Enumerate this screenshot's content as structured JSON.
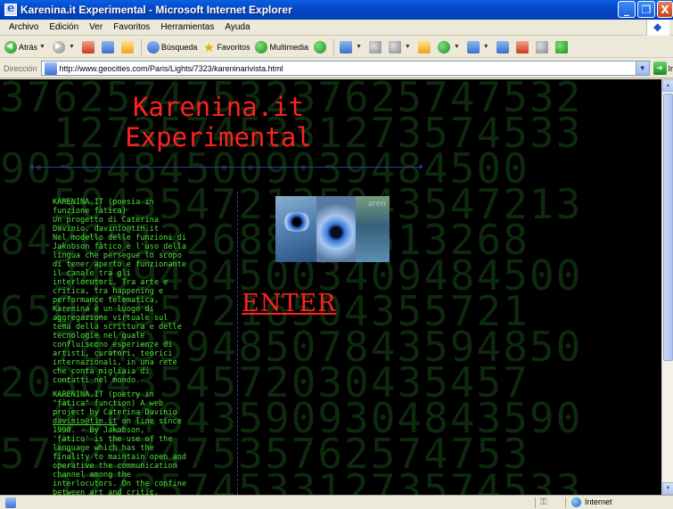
{
  "window": {
    "title": "Karenina.it Experimental - Microsoft Internet Explorer",
    "controls": [
      "_",
      "❐",
      "X"
    ]
  },
  "menu": [
    "Archivo",
    "Edición",
    "Ver",
    "Favoritos",
    "Herramientas",
    "Ayuda"
  ],
  "toolbar": {
    "back_label": "Atrás",
    "search_label": "Búsqueda",
    "favorites_label": "Favoritos",
    "multimedia_label": "Multimedia"
  },
  "address": {
    "label": "Dirección",
    "url": "http://www.geocities.com/Paris/Lights/7323/kareninarivista.html",
    "go_label": "Ir"
  },
  "page": {
    "title_line1": "Karenina.it",
    "title_line2": "Experimental",
    "enter_label": "ENTER",
    "image_tag": "aren",
    "text_it": "KARENINA.IT (poesia in\nfunzione fàtica)\nUn progetto di Caterina\nDavinio. davinio@tin.it\nNel modello delle funzioni di\nJakobson fàtico è l'uso della\nlingua che persegue lo scopo\ndi tener aperto e funzionante\nil canale tra gli\ninterlocutori. Tra arte e\ncritica, tra happening e\nperformance telematica,\nKarenina è un luogo di\naggregazione virtuale sul\ntema della scrittura e delle\ntecnologie nel quale\nconfluiscono esperienze di\nartisti, curatori, teorici\ninternazionali, in una rete\nche conta migliaia di\ncontatti nel mondo.",
    "text_en_1": "KARENINA.IT (poetry in\n\"fàtica\" function) A web\nproject by Caterina Davinio\n",
    "text_en_link": "davinio@tin.it",
    "text_en_2": " on line since\n1998. - By Jakobson,\n'fàtico' is the use of the\nlanguage which has the\nfinality to maintain open and\noperative the communication\nchannel among the\ninterlocutors. On the confine\nbetween art and critic,",
    "background_digits": [
      "37625747532",
      "1273574533",
      "9039484500",
      "5043547213",
      "8426513268",
      "3409484500",
      "6504355721",
      "7843594850",
      "2030435457",
      "9304843590",
      "5762574753",
      "1273574533"
    ]
  },
  "status": {
    "zone_label": "Internet"
  },
  "colors": {
    "title_red": "#ff2020",
    "text_green": "#4fe03a",
    "background": "#000000",
    "rule_blue": "#2f3f8f"
  }
}
